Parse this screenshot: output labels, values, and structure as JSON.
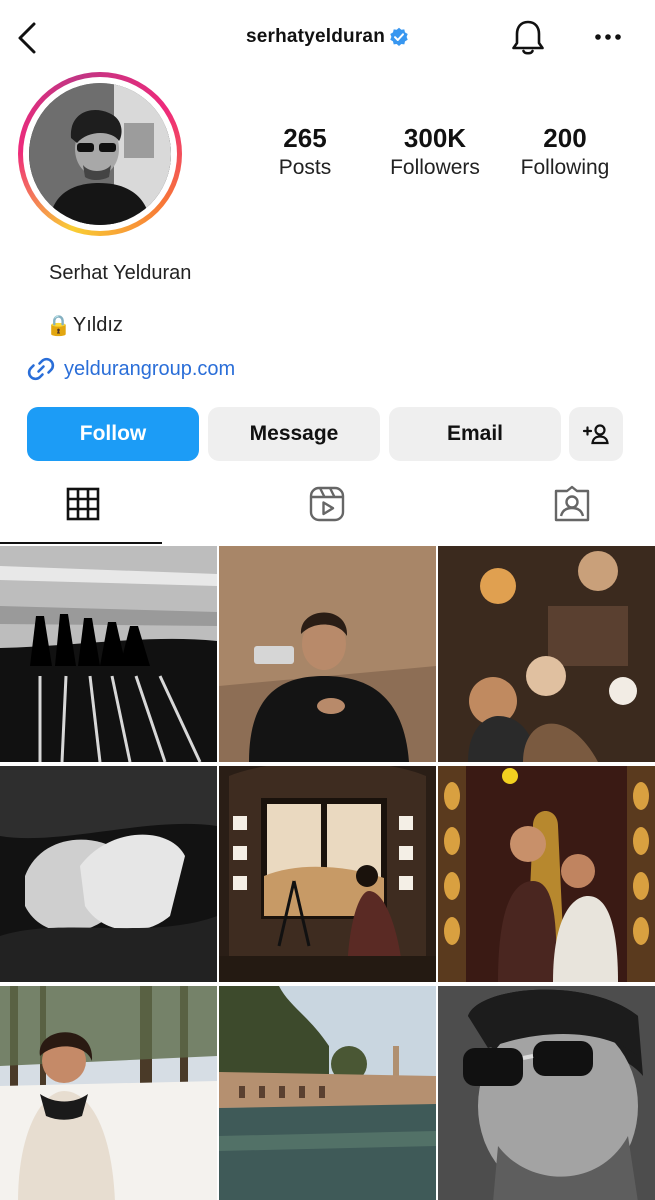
{
  "header": {
    "username": "serhatyelduran",
    "icons": {
      "back": "chevron-left-icon",
      "verified": "verified-badge-icon",
      "bell": "bell-icon",
      "more": "more-horizontal-icon"
    }
  },
  "profile": {
    "stats": [
      {
        "value": "265",
        "label": "Posts"
      },
      {
        "value": "300K",
        "label": "Followers"
      },
      {
        "value": "200",
        "label": "Following"
      }
    ],
    "full_name": "Serhat Yelduran",
    "bio_emoji": "🔒",
    "bio_text": "Yıldız",
    "link": "yeldurangroup.com"
  },
  "actions": {
    "follow": "Follow",
    "message": "Message",
    "email": "Email",
    "add_user_icon": "add-user-icon"
  },
  "tabs": [
    {
      "icon": "grid-icon",
      "active": true
    },
    {
      "icon": "reels-icon",
      "active": false
    },
    {
      "icon": "tagged-icon",
      "active": false
    }
  ],
  "colors": {
    "follow_button": "#1c9cf6",
    "secondary_button": "#efefef",
    "link": "#2a6ed8",
    "verified": "#3897f0"
  }
}
